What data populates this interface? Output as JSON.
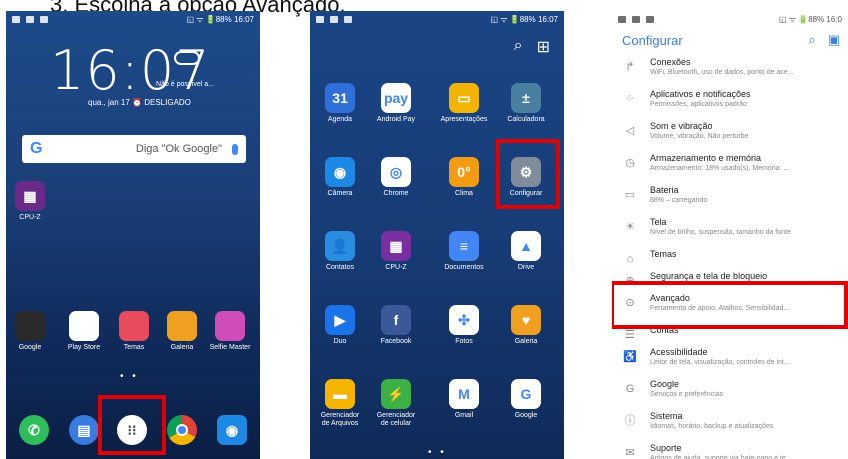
{
  "step_title": "3.  Escolha a opção Avançado.",
  "phone1": {
    "status_time": "◱ ᯤ 🔋88% 16:07",
    "clock": "16:07",
    "weather": "Não é possível a...",
    "date": "qua., jan 17  ⏰ DESLIGADO",
    "search_placeholder": "Diga \"Ok Google\"",
    "google_letter": "G",
    "cpu_label": "CPU-Z",
    "apps": [
      {
        "label": "Google",
        "icon": "google-folder-icon",
        "color": "#2a2a2a"
      },
      {
        "label": "Play Store",
        "icon": "play-store-icon",
        "color": "#ffffff"
      },
      {
        "label": "Temas",
        "icon": "themes-icon",
        "color": "#e84b5c"
      },
      {
        "label": "Galeria",
        "icon": "gallery-icon",
        "color": "#f0a020"
      },
      {
        "label": "Selfie Master",
        "icon": "selfie-master-icon",
        "color": "#d04cb8"
      }
    ],
    "dock": [
      "phone-icon",
      "messages-icon",
      "all-apps-icon",
      "chrome-icon",
      "camera-icon"
    ]
  },
  "phone2": {
    "status_time": "◱ ᯤ 🔋88% 16:07",
    "apps": [
      {
        "label": "Agenda",
        "color": "#2f6fd8",
        "glyph": "31"
      },
      {
        "label": "Android Pay",
        "color": "#ffffff",
        "glyph": "pay"
      },
      {
        "label": "Apresentações",
        "color": "#f2b400",
        "glyph": "▭"
      },
      {
        "label": "Calculadora",
        "color": "#4a7fa0",
        "glyph": "±"
      },
      {
        "label": "Câmera",
        "color": "#1e88e5",
        "glyph": "◉"
      },
      {
        "label": "Chrome",
        "color": "#ffffff",
        "glyph": "◎"
      },
      {
        "label": "Clima",
        "color": "#f39c12",
        "glyph": "0°"
      },
      {
        "label": "Configurar",
        "color": "#7f8c9b",
        "glyph": "⚙"
      },
      {
        "label": "Contatos",
        "color": "#2b8de0",
        "glyph": "👤"
      },
      {
        "label": "CPU-Z",
        "color": "#7a2fa0",
        "glyph": "▦"
      },
      {
        "label": "Documentos",
        "color": "#4285f4",
        "glyph": "≡"
      },
      {
        "label": "Drive",
        "color": "#ffffff",
        "glyph": "▲"
      },
      {
        "label": "Duo",
        "color": "#1a73e8",
        "glyph": "▶"
      },
      {
        "label": "Facebook",
        "color": "#3b5998",
        "glyph": "f"
      },
      {
        "label": "Fotos",
        "color": "#ffffff",
        "glyph": "✣"
      },
      {
        "label": "Galeria",
        "color": "#f0a020",
        "glyph": "♥"
      },
      {
        "label": "Gerenciador de Arquivos",
        "color": "#f4b400",
        "glyph": "▬"
      },
      {
        "label": "Gerenciador de celular",
        "color": "#3cb043",
        "glyph": "⚡"
      },
      {
        "label": "Gmail",
        "color": "#ffffff",
        "glyph": "M"
      },
      {
        "label": "Google",
        "color": "#ffffff",
        "glyph": "G"
      }
    ]
  },
  "phone3": {
    "status_time": "◱ ᯤ 🔋88% 16:0",
    "title": "Configurar",
    "items": [
      {
        "name": "Conexões",
        "sub": "WiFi, Bluetooth, uso de dados, ponto de ace...",
        "icon": "↱"
      },
      {
        "name": "Aplicativos e notificações",
        "sub": "Permissões, aplicativos padrão",
        "icon": "⁘"
      },
      {
        "name": "Som e vibração",
        "sub": "Volume, vibração, Não perturbe",
        "icon": "◁"
      },
      {
        "name": "Armazenamento e memória",
        "sub": "Armazenamento: 18% usado(s), Memória: ...",
        "icon": "◷"
      },
      {
        "name": "Bateria",
        "sub": "88% – carregando",
        "icon": "▭"
      },
      {
        "name": "Tela",
        "sub": "Nível de brilho, suspensão, tamanho da fonte",
        "icon": "☀"
      },
      {
        "name": "Temas",
        "sub": "",
        "icon": "⌂"
      },
      {
        "name": "Segurança e tela de bloqueio",
        "sub": "",
        "icon": "⊕"
      },
      {
        "name": "Avançado",
        "sub": "Ferramenta de apoio, Atalhos, Sensibilidad...",
        "icon": "⊙"
      },
      {
        "name": "Contas",
        "sub": "",
        "icon": "☰"
      },
      {
        "name": "Acessibilidade",
        "sub": "Leitor de tela, visualização, controles de int...",
        "icon": "♿"
      },
      {
        "name": "Google",
        "sub": "Serviços e preferências",
        "icon": "G"
      },
      {
        "name": "Sistema",
        "sub": "Idiomas, horário, backup e atualizações",
        "icon": "ⓘ"
      },
      {
        "name": "Suporte",
        "sub": "Artigos de ajuda, suporte via bate-papo e te...",
        "icon": "✉"
      }
    ]
  }
}
